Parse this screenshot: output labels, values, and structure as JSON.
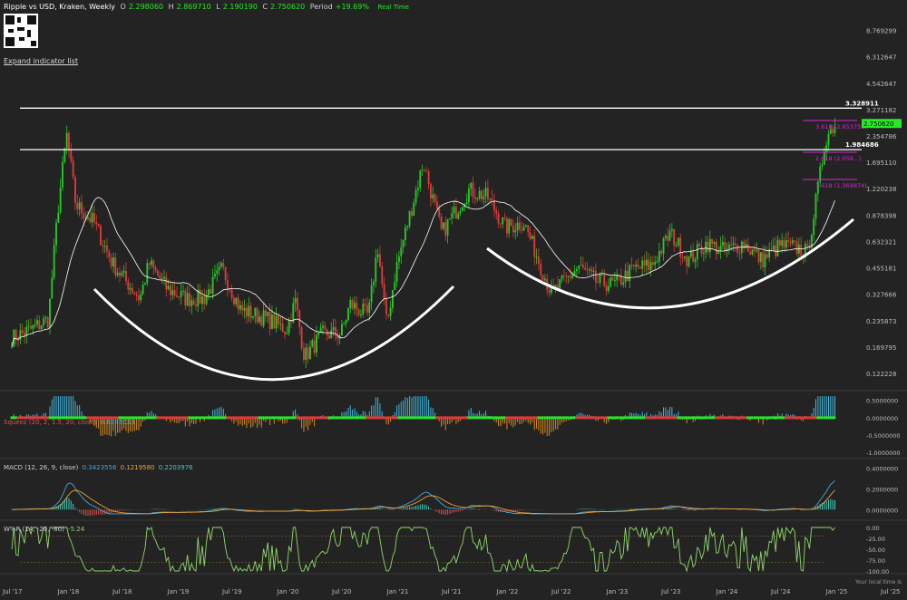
{
  "header": {
    "symbol": "Ripple vs USD, Kraken, Weekly",
    "open_label": "O",
    "open": "2.298060",
    "high_label": "H",
    "high": "2.869710",
    "low_label": "L",
    "low": "2.190190",
    "close_label": "C",
    "close": "2.750620",
    "period_label": "Period",
    "period": "+19.69%",
    "realtime": "Real Time"
  },
  "expand_link": "Expand indicator list",
  "footer_note": "Your local time is",
  "colors": {
    "background": "#232323",
    "up": "#26c926",
    "down": "#e03a3a",
    "ma": "#ffffff",
    "fib": "#d228d2",
    "price_tag": "#28e828",
    "squeeze_on": "#29e629",
    "squeeze_off": "#e03a3a",
    "macd_line": "#3fa9e0",
    "signal_line": "#f0a030",
    "wr_line": "#8fd96a"
  },
  "chart_data": {
    "type": "candlestick",
    "scale": "log",
    "x_tick_labels": [
      "Jul '17",
      "Jan '18",
      "Jul '18",
      "Jan '19",
      "Jul '19",
      "Jan '20",
      "Jul '20",
      "Jan '21",
      "Jul '21",
      "Jan '22",
      "Jul '22",
      "Jan '23",
      "Jul '23",
      "Jan '24",
      "Jul '24",
      "Jan '25",
      "Jul '25"
    ],
    "y_tick_labels": [
      "8.769299",
      "6.312647",
      "4.542647",
      "3.271182",
      "2.354786",
      "1.695110",
      "1.220238",
      "0.878398",
      "0.632321",
      "0.455181",
      "0.327666",
      "0.235873",
      "0.169795",
      "0.122228"
    ],
    "price_path": [
      [
        "Jul '17",
        0.19
      ],
      [
        "Sep '17",
        0.21
      ],
      [
        "Nov '17",
        0.24
      ],
      [
        "Dec '17",
        0.9
      ],
      [
        "Jan '18",
        2.4
      ],
      [
        "Feb '18",
        1.0
      ],
      [
        "Apr '18",
        0.8
      ],
      [
        "Jun '18",
        0.48
      ],
      [
        "Sep '18",
        0.31
      ],
      [
        "Oct '18",
        0.48
      ],
      [
        "Dec '18",
        0.35
      ],
      [
        "Feb '19",
        0.31
      ],
      [
        "Apr '19",
        0.31
      ],
      [
        "Jun '19",
        0.45
      ],
      [
        "Aug '19",
        0.27
      ],
      [
        "Nov '19",
        0.24
      ],
      [
        "Jan '20",
        0.21
      ],
      [
        "Feb '20",
        0.3
      ],
      [
        "Mar '20",
        0.15
      ],
      [
        "May '20",
        0.2
      ],
      [
        "Jul '20",
        0.2
      ],
      [
        "Aug '20",
        0.29
      ],
      [
        "Oct '20",
        0.25
      ],
      [
        "Nov '20",
        0.6
      ],
      [
        "Dec '20",
        0.22
      ],
      [
        "Jan '21",
        0.45
      ],
      [
        "Apr '21",
        1.7
      ],
      [
        "Jun '21",
        0.7
      ],
      [
        "Sep '21",
        1.2
      ],
      [
        "Nov '21",
        1.1
      ],
      [
        "Jan '22",
        0.75
      ],
      [
        "Mar '22",
        0.8
      ],
      [
        "Jun '22",
        0.33
      ],
      [
        "Sep '22",
        0.46
      ],
      [
        "Nov '22",
        0.38
      ],
      [
        "Jan '23",
        0.37
      ],
      [
        "Mar '23",
        0.45
      ],
      [
        "May '23",
        0.47
      ],
      [
        "Jul '23",
        0.7
      ],
      [
        "Sep '23",
        0.5
      ],
      [
        "Nov '23",
        0.62
      ],
      [
        "Jan '24",
        0.56
      ],
      [
        "Mar '24",
        0.62
      ],
      [
        "May '24",
        0.5
      ],
      [
        "Jul '24",
        0.6
      ],
      [
        "Sep '24",
        0.58
      ],
      [
        "Oct '24",
        0.55
      ],
      [
        "Nov '24",
        1.1
      ],
      [
        "Dec '24",
        2.3
      ],
      [
        "Jan '25",
        2.75
      ]
    ],
    "horizontal_levels": [
      {
        "label": "3.328911",
        "value": 3.328911
      },
      {
        "label": "1.984686",
        "value": 1.984686
      }
    ],
    "fib_levels": [
      {
        "label": "3.618 (2.853759)",
        "value": 2.853759
      },
      {
        "label": "2.618 (2.059...)",
        "value": 1.92
      },
      {
        "label": "1.618 (1.369874)",
        "value": 1.369874
      }
    ],
    "last_price_tag": "2.750620",
    "annotations": [
      "cup-and-handle arc 2018–2020",
      "cup arc 2022–2024"
    ],
    "indicators": [
      {
        "name": "Squeez (20, 2, 1.5, 20, close)",
        "value": "0.6345023",
        "y_tick_labels": [
          "0.5000000",
          "0.0000000",
          "-0.5000000",
          "-1.0000000"
        ],
        "ylim": [
          -1.1,
          0.65
        ]
      },
      {
        "name": "MACD (12, 26, 9, close)",
        "values": [
          "0.3423556",
          "0.1219580",
          "0.2203976"
        ],
        "y_tick_labels": [
          "0.4000000",
          "0.2000000",
          "0.0000000"
        ],
        "ylim": [
          -0.05,
          0.42
        ]
      },
      {
        "name": "W%R (14, -20, -80)",
        "value": "-5.24",
        "y_tick_labels": [
          "0.00",
          "-25.00",
          "-50.00",
          "-75.00",
          "-100.00"
        ],
        "ylim": [
          -100,
          0
        ]
      }
    ]
  }
}
